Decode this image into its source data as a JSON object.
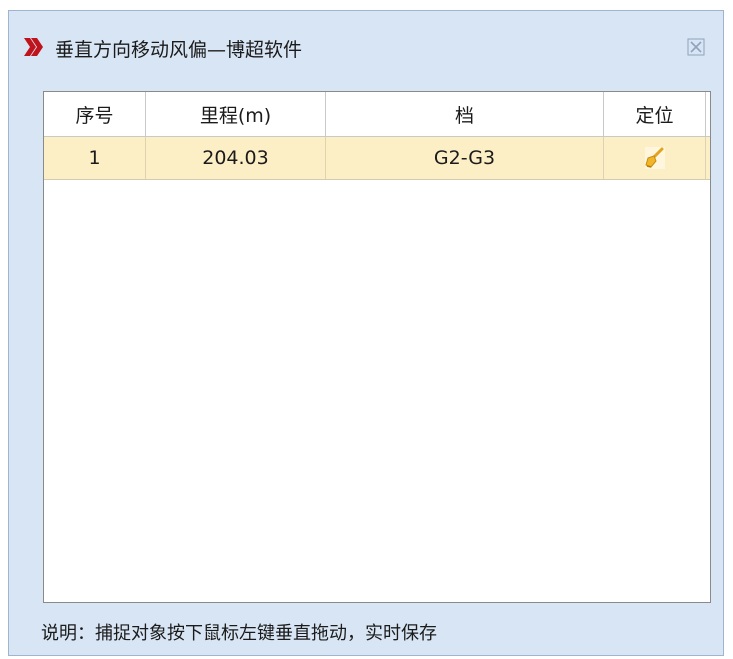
{
  "window": {
    "title": "垂直方向移动风偏—博超软件",
    "icons": {
      "title": "red-double-chevron-icon",
      "close": "close-x-icon"
    },
    "accent_color": "#c0141c"
  },
  "table": {
    "columns": [
      "序号",
      "里程(m)",
      "档",
      "定位"
    ],
    "rows": [
      {
        "index": "1",
        "mileage": "204.03",
        "span": "G2-G3",
        "locate_icon": "locate-brush-icon"
      }
    ],
    "selected_row_color": "#fcefc6"
  },
  "hint": "说明：捕捉对象按下鼠标左键垂直拖动，实时保存"
}
